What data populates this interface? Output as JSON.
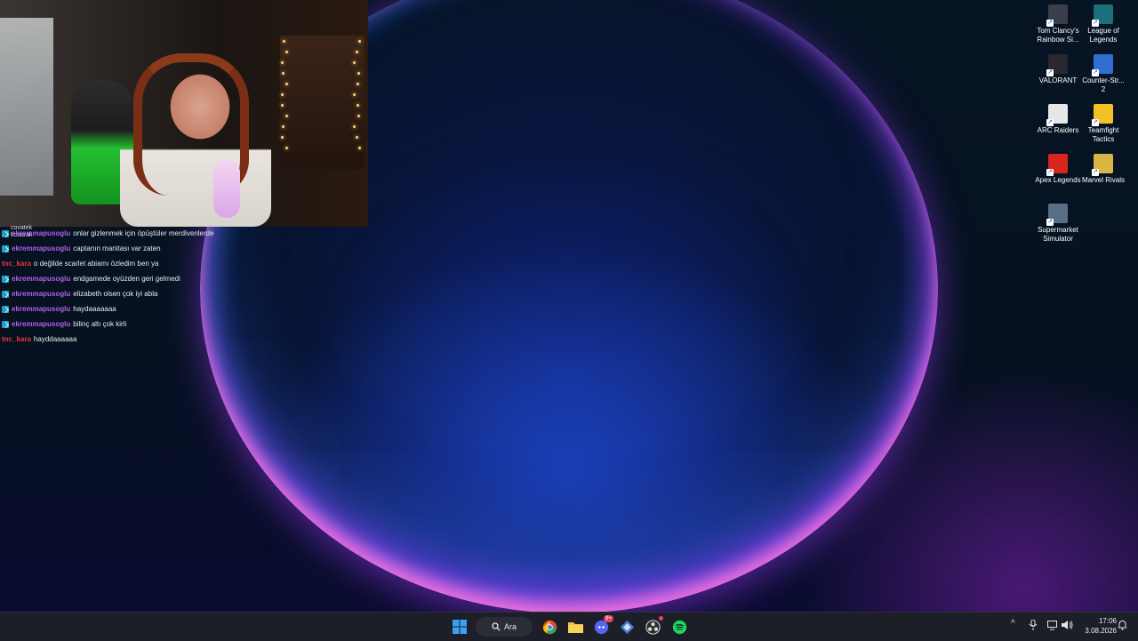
{
  "colors": {
    "username_purple": "#b05ef0",
    "username_red": "#e5363b",
    "taskbar_bg": "#1c1f27"
  },
  "stream_overlay": {
    "overlap_name_top": "covatek",
    "overlap_name_bottom": "kosarak"
  },
  "chat": {
    "messages": [
      {
        "user": "ekremmapusoglu",
        "text": "onlar gizlenmek için öpüştüler merdivenlerde",
        "badge": "prime-icon",
        "color": "#b05ef0"
      },
      {
        "user": "ekremmapusoglu",
        "text": "captanın manitası var zaten",
        "badge": "prime-icon",
        "color": "#b05ef0"
      },
      {
        "user": "tnc_kara",
        "text": "o değilde scarlet abiamı özledim ben ya",
        "badge": "",
        "color": "#e5363b"
      },
      {
        "user": "ekremmapusoglu",
        "text": "endgamede oyüzden geri gelmedi",
        "badge": "prime-icon",
        "color": "#b05ef0"
      },
      {
        "user": "ekremmapusoglu",
        "text": "elizabeth olsen çok iyi abla",
        "badge": "prime-icon",
        "color": "#b05ef0"
      },
      {
        "user": "ekremmapusoglu",
        "text": "haydaaaaaaa",
        "badge": "prime-icon",
        "color": "#b05ef0"
      },
      {
        "user": "ekremmapusoglu",
        "text": "bilinç altı çok kirli",
        "badge": "prime-icon",
        "color": "#b05ef0"
      },
      {
        "user": "tnc_kara",
        "text": "hayddaaaaaa",
        "badge": "",
        "color": "#e5363b"
      }
    ]
  },
  "desktop_icons": [
    {
      "label": "Tom Clancy's Rainbow Si...",
      "icon": "rainbow-six-icon",
      "color": "#3a3f4a"
    },
    {
      "label": "League of Legends",
      "icon": "league-of-legends-icon",
      "color": "#1a6f7a"
    },
    {
      "label": "VALORANT",
      "icon": "valorant-icon",
      "color": "#2a2730"
    },
    {
      "label": "Counter-Str... 2",
      "icon": "counter-strike-icon",
      "color": "#2f6fd0"
    },
    {
      "label": "ARC Raiders",
      "icon": "arc-raiders-icon",
      "color": "#e7e7e7"
    },
    {
      "label": "Teamfight Tactics",
      "icon": "teamfight-tactics-icon",
      "color": "#f2c224"
    },
    {
      "label": "Apex Legends",
      "icon": "apex-legends-icon",
      "color": "#d8261f"
    },
    {
      "label": "Marvel Rivals",
      "icon": "marvel-rivals-icon",
      "color": "#d9b545"
    },
    {
      "label": "Supermarket Simulator",
      "icon": "supermarket-simulator-icon",
      "color": "#5a6f86"
    }
  ],
  "taskbar": {
    "search_label": "Ara",
    "apps": [
      {
        "name": "start-button",
        "icon": "windows-logo-icon",
        "color": "#3aa0f0"
      },
      {
        "name": "chrome-button",
        "icon": "chrome-icon",
        "color": "#e8453c"
      },
      {
        "name": "file-explorer-button",
        "icon": "folder-icon",
        "color": "#f4c042"
      },
      {
        "name": "discord-button",
        "icon": "discord-icon",
        "color": "#5865f2",
        "badge": "9+"
      },
      {
        "name": "battlenet-button",
        "icon": "game-launcher-icon",
        "color": "#4a7bd0"
      },
      {
        "name": "obs-button",
        "icon": "obs-icon",
        "color": "#2b2b2b"
      },
      {
        "name": "spotify-button",
        "icon": "spotify-icon",
        "color": "#1ed760"
      }
    ],
    "tray": {
      "chevron": "^",
      "time": "17:06",
      "date": "3.08.2026"
    }
  }
}
